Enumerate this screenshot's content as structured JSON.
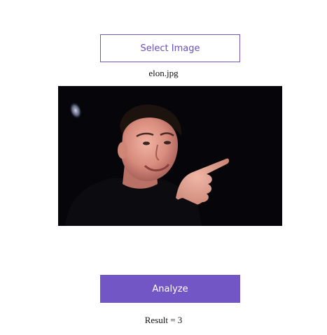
{
  "upload": {
    "select_label": "Select Image",
    "file_name": "elon.jpg"
  },
  "preview": {
    "icon": "photo-preview"
  },
  "actions": {
    "analyze_label": "Analyze"
  },
  "result": {
    "text": "Result = 3"
  },
  "colors": {
    "accent": "#7356c6",
    "preview_background": "#05050a"
  }
}
